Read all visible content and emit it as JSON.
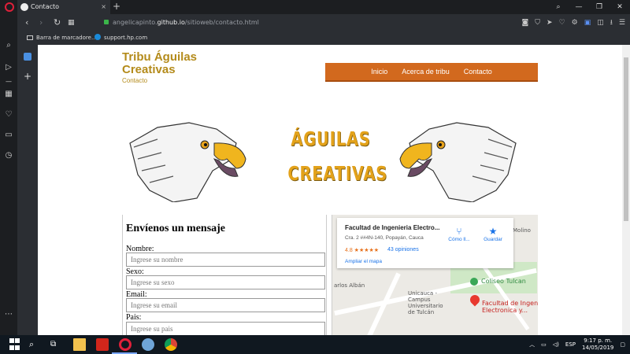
{
  "browser": {
    "tab_title": "Contacto",
    "new_tab": "+",
    "url_prefix": "angelicapinto.",
    "url_domain": "github.io",
    "url_path": "/sitioweb/contacto.html",
    "bookmarks": [
      "Barra de marcadore...",
      "support.hp.com"
    ]
  },
  "site": {
    "title": "Tribu Águilas Creativas",
    "subtitle": "Contacto",
    "nav": [
      "Inicio",
      "Acerca de tribu",
      "Contacto"
    ],
    "banner_line1": "ÁGUILAS",
    "banner_line2": "CREATIVAS"
  },
  "form": {
    "title": "Envíenos un mensaje",
    "fields": [
      {
        "label": "Nombre:",
        "placeholder": "Ingrese su nombre"
      },
      {
        "label": "Sexo:",
        "placeholder": "Ingrese su sexo"
      },
      {
        "label": "Email:",
        "placeholder": "Ingrese su email"
      },
      {
        "label": "Pais:",
        "placeholder": "Ingrese su pais"
      }
    ]
  },
  "map": {
    "place_name": "Facultad de Ingenieria Electro...",
    "address": "Cra. 2 ##4N-140, Popayán, Cauca",
    "rating": "4.8 ★★★★★",
    "reviews": "43 opiniones",
    "enlarge": "Ampliar el mapa",
    "directions": "Cómo ll...",
    "save": "Guardar",
    "labels": {
      "molino": "Molino",
      "carlos": "arlos Albán",
      "coliseo": "Coliseo Tulcan",
      "unicauca": "Unicauca -\nCampus\nUniversitario\nde Tulcán",
      "facultad": "Facultad de Ingenie\nElectronica y..."
    }
  },
  "taskbar": {
    "lang": "ESP",
    "time": "9:17 p. m.",
    "date": "14/05/2019"
  }
}
